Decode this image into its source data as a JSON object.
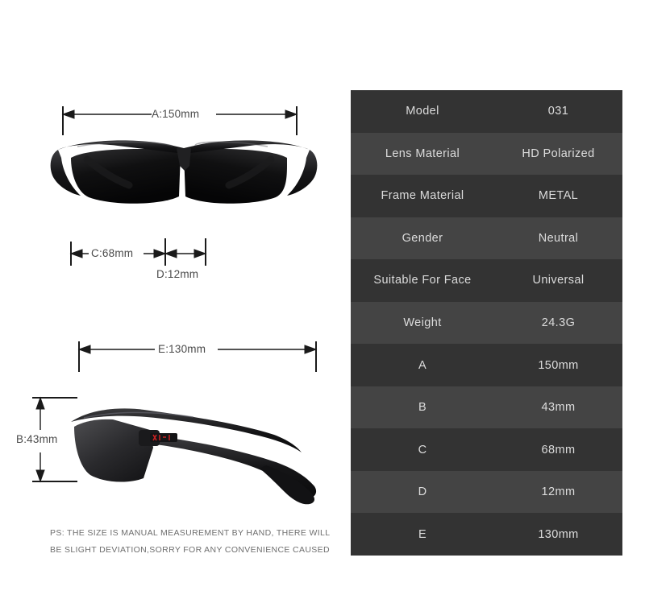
{
  "diagram": {
    "front_view": {
      "icon": "sunglasses-front-view",
      "alt": "Black semi-rimless sport sunglasses, front view"
    },
    "side_view": {
      "icon": "sunglasses-side-view",
      "alt": "Black semi-rimless sport sunglasses, side view",
      "temple_brand_mark": "brand"
    },
    "measurements": [
      {
        "key": "A",
        "label": "A:150mm",
        "orientation": "horizontal"
      },
      {
        "key": "C",
        "label": "C:68mm",
        "orientation": "horizontal"
      },
      {
        "key": "D",
        "label": "D:12mm",
        "orientation": "horizontal"
      },
      {
        "key": "E",
        "label": "E:130mm",
        "orientation": "horizontal"
      },
      {
        "key": "B",
        "label": "B:43mm",
        "orientation": "vertical"
      }
    ]
  },
  "disclaimer": {
    "line1": "PS: THE SIZE IS MANUAL MEASUREMENT BY HAND, THERE WILL",
    "line2": "BE SLIGHT DEVIATION,SORRY FOR ANY CONVENIENCE CAUSED"
  },
  "spec_table": {
    "rows": [
      {
        "label": "Model",
        "value": "031"
      },
      {
        "label": "Lens Material",
        "value": "HD Polarized"
      },
      {
        "label": "Frame Material",
        "value": "METAL"
      },
      {
        "label": "Gender",
        "value": "Neutral"
      },
      {
        "label": "Suitable For Face",
        "value": "Universal"
      },
      {
        "label": "Weight",
        "value": "24.3G"
      },
      {
        "label": "A",
        "value": "150mm"
      },
      {
        "label": "B",
        "value": "43mm"
      },
      {
        "label": "C",
        "value": "68mm"
      },
      {
        "label": "D",
        "value": "12mm"
      },
      {
        "label": "E",
        "value": "130mm"
      }
    ]
  },
  "colors": {
    "page_background": "#ffffff",
    "row_dark": "#333333",
    "row_light": "#444444",
    "table_text": "#dcdcdc",
    "dimension_text": "#4a4a4a",
    "disclaimer_text": "#6e6e6e",
    "brand_mark": "#cc2222"
  }
}
